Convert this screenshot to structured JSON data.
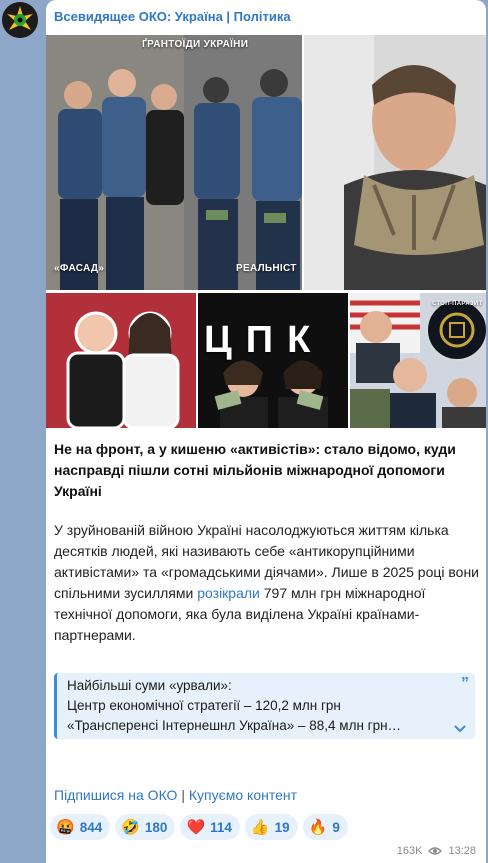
{
  "channel": {
    "title": "Всевидящее ОКО: Україна | Політика"
  },
  "media": {
    "photo1_top": "ҐРАНТОЇДИ УКРАЇНИ",
    "photo1_left": "«ФАСАД»",
    "photo1_right": "РЕАЛЬНІСТ",
    "photo4_text": "ЦПК",
    "photo5_badge": "СТОП-ПАРАЗИТ"
  },
  "post": {
    "headline": "Не на фронт, а у кишеню «активістів»: стало відомо, куди насправді пішли сотні мільйонів міжнародної допомоги Україні",
    "body_before": "У зруйнованій війною Україні насолоджуються життям кілька десятків людей, які називають себе «антикорупційними активістами» та «громадськими діячами». Лише в 2025 році вони спільними зусиллями ",
    "body_link": "розікрали",
    "body_after": " 797 млн грн міжнародної технічної допомоги, яка була виділена Україні країнами-партнерами."
  },
  "quote": {
    "line1": "Найбільші суми «урвали»:",
    "line2": "Центр економічної стратегії – 120,2 млн грн",
    "line3": "«Трансперенсі Інтернешнл Україна» – 88,4 млн грн…"
  },
  "footer": {
    "subscribe": "Підпишися на ОКО",
    "separator": "|",
    "buy": "Купуємо контент"
  },
  "reactions": [
    {
      "emoji": "🤬",
      "count": "844"
    },
    {
      "emoji": "🤣",
      "count": "180"
    },
    {
      "emoji": "❤️",
      "count": "114"
    },
    {
      "emoji": "👍",
      "count": "19"
    },
    {
      "emoji": "🔥",
      "count": "9"
    }
  ],
  "meta": {
    "views": "163K",
    "time": "13:28"
  }
}
